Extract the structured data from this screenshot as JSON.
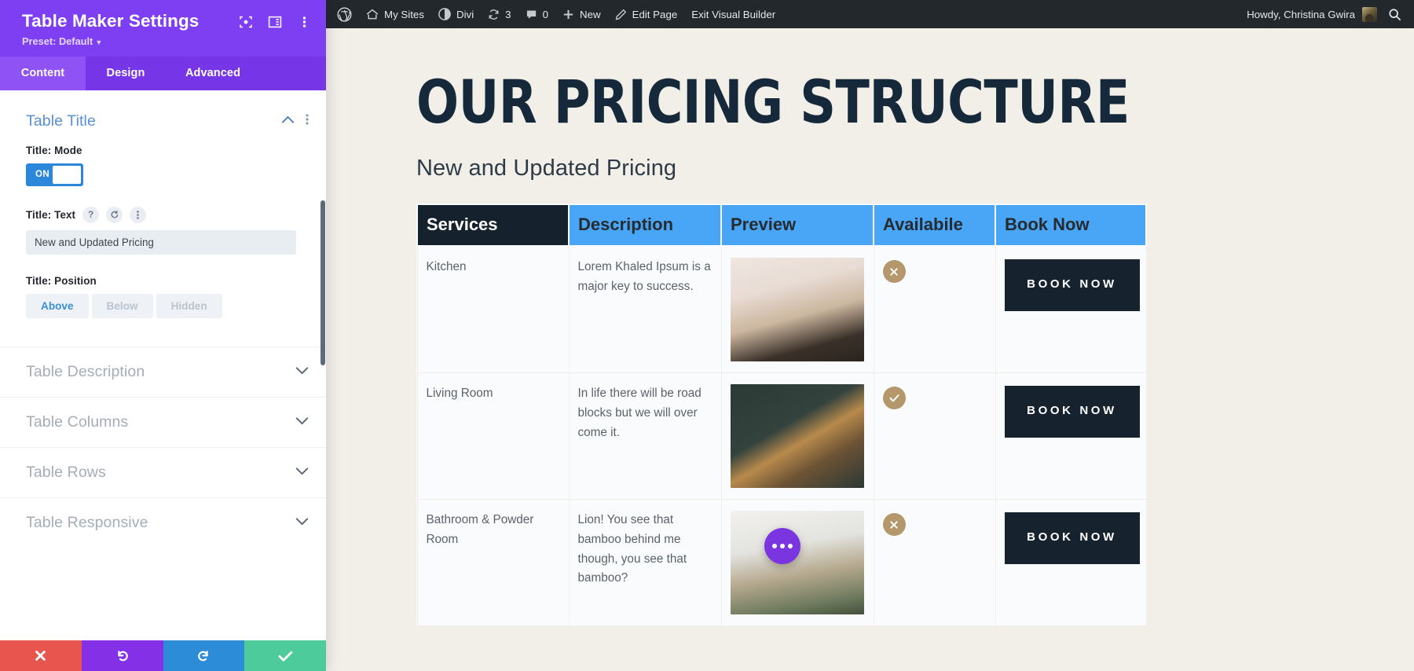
{
  "panel": {
    "title": "Table Maker Settings",
    "preset_label": "Preset: Default",
    "icons": {
      "focus": "focus-target-icon",
      "layout": "panel-layout-icon",
      "kebab": "kebab-menu-icon"
    },
    "tabs": [
      {
        "label": "Content",
        "active": true
      },
      {
        "label": "Design",
        "active": false
      },
      {
        "label": "Advanced",
        "active": false
      }
    ],
    "sections": {
      "table_title": {
        "heading": "Table Title",
        "mode_label": "Title: Mode",
        "mode_value": "ON",
        "text_label": "Title: Text",
        "text_value": "New and Updated Pricing",
        "position_label": "Title: Position",
        "position_options": [
          {
            "label": "Above",
            "active": true
          },
          {
            "label": "Below",
            "active": false
          },
          {
            "label": "Hidden",
            "active": false
          }
        ]
      },
      "collapsed": [
        {
          "label": "Table Description"
        },
        {
          "label": "Table Columns"
        },
        {
          "label": "Table Rows"
        },
        {
          "label": "Table Responsive"
        }
      ]
    },
    "footer_buttons": [
      {
        "name": "close-button",
        "icon": "close-x-icon",
        "color": "#e8554e"
      },
      {
        "name": "undo-button",
        "icon": "undo-arrow-icon",
        "color": "#8430e6"
      },
      {
        "name": "redo-button",
        "icon": "redo-arrow-icon",
        "color": "#2d8cd8"
      },
      {
        "name": "save-button",
        "icon": "checkmark-icon",
        "color": "#4ecb9a"
      }
    ]
  },
  "adminbar": {
    "wp_logo": "wordpress-logo-icon",
    "items": [
      {
        "label": "My Sites",
        "icon": "sites-house-icon"
      },
      {
        "label": "Divi",
        "icon": "divi-logo-icon"
      },
      {
        "label": "3",
        "icon": "updates-refresh-icon"
      },
      {
        "label": "0",
        "icon": "comment-bubble-icon"
      },
      {
        "label": "New",
        "icon": "plus-icon"
      },
      {
        "label": "Edit Page",
        "icon": "pencil-icon"
      },
      {
        "label": "Exit Visual Builder",
        "icon": ""
      }
    ],
    "howdy": "Howdy, Christina Gwira",
    "avatar": "user-avatar",
    "search_icon": "search-icon"
  },
  "page": {
    "heading": "OUR PRICING STRUCTURE",
    "subheading": "New and Updated Pricing",
    "table": {
      "headers": [
        "Services",
        "Description",
        "Preview",
        "Availabile",
        "Book Now"
      ],
      "rows": [
        {
          "service": "Kitchen",
          "description": "Lorem Khaled Ipsum is a major key to success.",
          "preview": "chandelier-photo",
          "available": false,
          "available_icon": "cross-circle-icon",
          "book_label": "BOOK NOW"
        },
        {
          "service": "Living Room",
          "description": "In life there will be road blocks but we will over come it.",
          "preview": "living-room-shelf-photo",
          "available": true,
          "available_icon": "check-circle-icon",
          "book_label": "BOOK NOW"
        },
        {
          "service": "Bathroom & Powder Room",
          "description": "Lion! You see that bamboo behind me though, you see that bamboo?",
          "preview": "bathroom-plant-photo",
          "available": false,
          "available_icon": "cross-circle-icon",
          "book_label": "BOOK NOW"
        }
      ]
    },
    "fab": "divi-options-fab"
  },
  "colors": {
    "panel_purple": "#7e3ff2",
    "header_blue": "#49a5f5",
    "header_dark": "#15222e",
    "avail_tan": "#b4976a",
    "page_bg": "#f2efe9"
  }
}
